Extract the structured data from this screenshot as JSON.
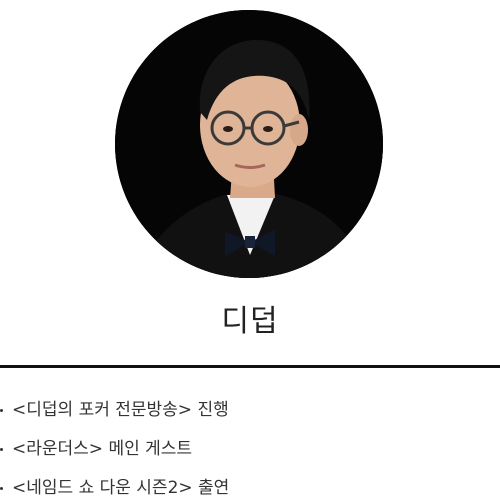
{
  "profile": {
    "name": "디덥",
    "avatar_icon": "portrait-photo",
    "credits": [
      "<디덥의 포커 전문방송> 진행",
      "<라운더스> 메인 게스트",
      "<네임드 쇼 다운 시즌2> 출연"
    ]
  }
}
